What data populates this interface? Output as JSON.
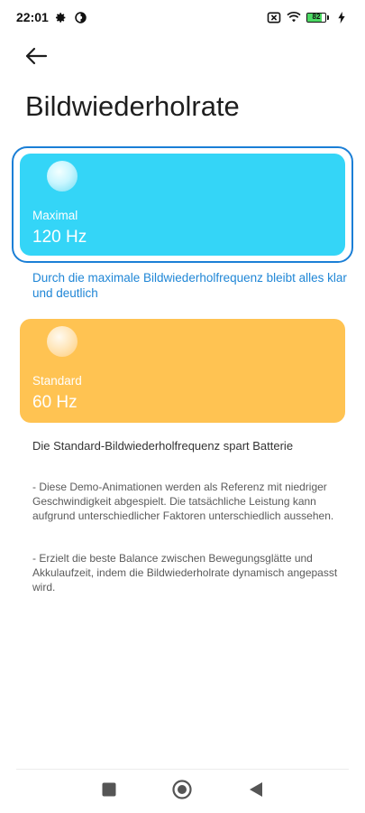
{
  "status_bar": {
    "time": "22:01",
    "battery_level": "82",
    "battery_fraction": 0.82,
    "icons": [
      "gear-icon",
      "vpn-icon",
      "sim-error-icon",
      "wifi-icon",
      "battery-icon",
      "charging-icon"
    ]
  },
  "header": {
    "back_icon": "arrow-left-icon",
    "title": "Bildwiederholrate"
  },
  "options": [
    {
      "label": "Maximal",
      "value": "120 Hz",
      "selected": true,
      "color": "#34d5f7",
      "description": "Durch die maximale Bildwiederholfrequenz bleibt alles klar und deutlich"
    },
    {
      "label": "Standard",
      "value": "60 Hz",
      "selected": false,
      "color": "#ffc352",
      "description": "Die Standard-Bildwiederholfrequenz spart Batterie"
    }
  ],
  "notes": [
    "- Diese Demo-Animationen werden als Referenz mit niedriger Geschwindigkeit abgespielt. Die tatsächliche Leistung kann aufgrund unterschiedlicher Faktoren unterschiedlich aussehen.",
    "- Erzielt die beste Balance zwischen Bewegungsglätte und Akkulaufzeit, indem die Bildwiederholrate dynamisch angepasst wird."
  ],
  "accent_color": "#1b7fd6",
  "nav_bar": {
    "items": [
      "recents-square-icon",
      "home-circle-icon",
      "back-triangle-icon"
    ]
  }
}
